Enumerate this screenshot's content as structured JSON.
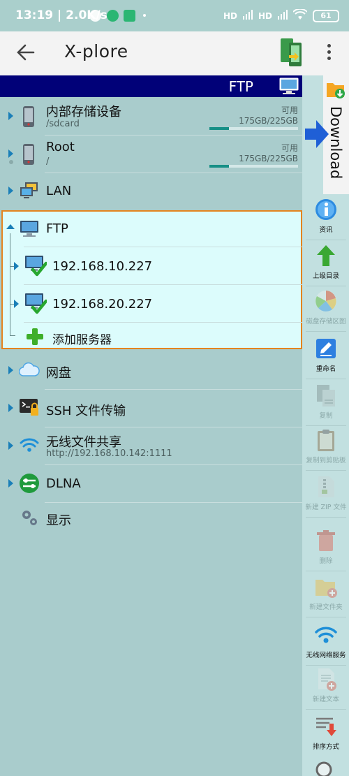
{
  "status": {
    "time": "13:19",
    "speed": "2.0K/s",
    "battery": "61",
    "sig1": "HD",
    "sig2": "HD"
  },
  "app": {
    "title": "X-plore"
  },
  "pathbar": {
    "title": "FTP"
  },
  "drives": [
    {
      "name": "内部存储设备",
      "path": "/sdcard",
      "free_label": "可用",
      "size": "175GB/225GB",
      "used_fraction": 0.22
    },
    {
      "name": "Root",
      "path": "/",
      "free_label": "可用",
      "size": "175GB/225GB",
      "used_fraction": 0.22
    }
  ],
  "lan": {
    "label": "LAN"
  },
  "ftp": {
    "label": "FTP",
    "servers": [
      "192.168.10.227",
      "192.168.20.227"
    ],
    "add_label": "添加服务器"
  },
  "cloud": {
    "label": "网盘"
  },
  "ssh": {
    "label": "SSH 文件传输"
  },
  "wifi": {
    "label": "无线文件共享",
    "url": "http://192.168.10.142:1111"
  },
  "dlna": {
    "label": "DLNA"
  },
  "display": {
    "label": "显示"
  },
  "download_tab": {
    "label": "Download"
  },
  "toolbar": [
    {
      "label": "资讯",
      "enabled": true
    },
    {
      "label": "上级目录",
      "enabled": true
    },
    {
      "label": "磁盘存储区图",
      "enabled": false
    },
    {
      "label": "重命名",
      "enabled": true
    },
    {
      "label": "复制",
      "enabled": false
    },
    {
      "label": "复制到剪贴板",
      "enabled": false
    },
    {
      "label": "新建 ZIP 文件",
      "enabled": false
    },
    {
      "label": "删除",
      "enabled": false
    },
    {
      "label": "新建文件夹",
      "enabled": false
    },
    {
      "label": "无线网络服务",
      "enabled": true
    },
    {
      "label": "新建文本",
      "enabled": false
    },
    {
      "label": "排序方式",
      "enabled": true
    }
  ]
}
